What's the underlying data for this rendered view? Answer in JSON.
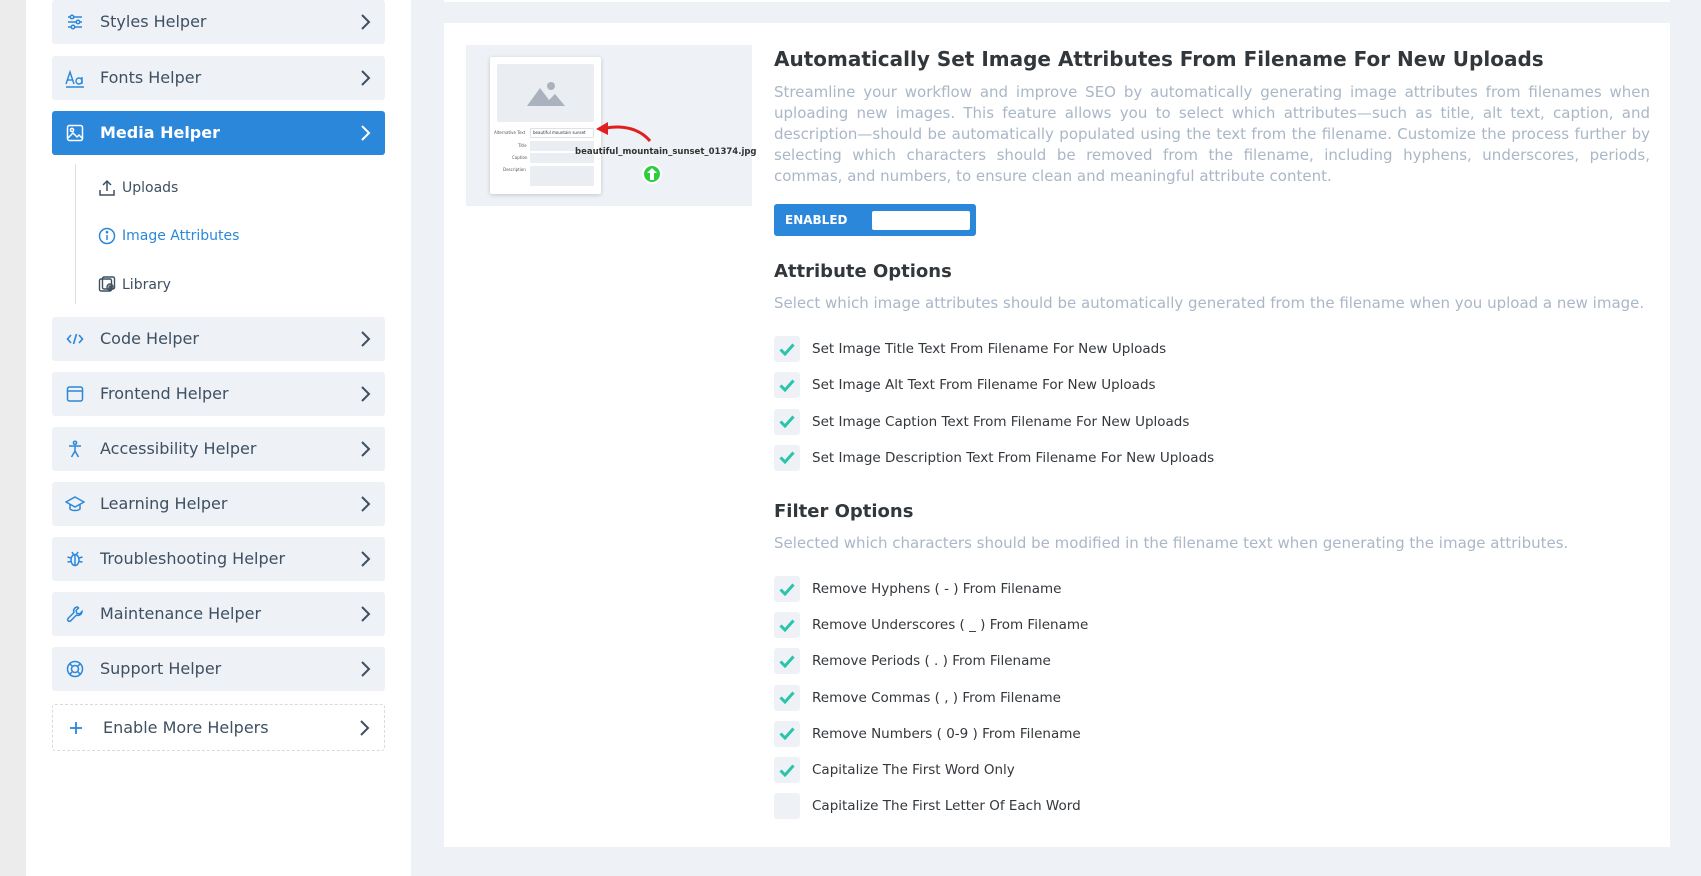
{
  "sidebar": {
    "helpers_top": [
      {
        "label": "Styles Helper",
        "icon": "sliders-icon"
      },
      {
        "label": "Fonts Helper",
        "icon": "font-icon"
      },
      {
        "label": "Media Helper",
        "icon": "image-icon"
      }
    ],
    "media_sub": [
      {
        "label": "Uploads",
        "icon": "upload-icon"
      },
      {
        "label": "Image Attributes",
        "icon": "info-icon"
      },
      {
        "label": "Library",
        "icon": "library-icon"
      }
    ],
    "helpers_bottom": [
      {
        "label": "Code Helper",
        "icon": "code-icon"
      },
      {
        "label": "Frontend Helper",
        "icon": "browser-icon"
      },
      {
        "label": "Accessibility Helper",
        "icon": "accessibility-icon"
      },
      {
        "label": "Learning Helper",
        "icon": "graduation-cap-icon"
      },
      {
        "label": "Troubleshooting Helper",
        "icon": "bug-icon"
      },
      {
        "label": "Maintenance Helper",
        "icon": "wrench-icon"
      },
      {
        "label": "Support Helper",
        "icon": "lifebuoy-icon"
      }
    ],
    "enable_more": {
      "label": "Enable More Helpers",
      "icon": "plus-icon"
    }
  },
  "main": {
    "thumbnail": {
      "alt_label": "Alternative Text",
      "alt_value": "beautiful mountain sunset",
      "title_label": "Title",
      "caption_label": "Caption",
      "description_label": "Description",
      "filename": "beautiful_mountain_sunset_01374.jpg"
    },
    "title": "Automatically Set Image Attributes From Filename For New Uploads",
    "description": "Streamline your workflow and improve SEO by automatically generating image attributes from filenames when uploading new images. This feature allows you to select which attributes—such as title, alt text, caption, and description—should be automatically populated using the text from the filename. Customize the process further by selecting which characters should be removed from the filename, including hyphens, underscores, periods, commas, and numbers, to ensure clean and meaningful attribute content.",
    "toggle": {
      "label": "ENABLED",
      "state": true
    },
    "attribute_options": {
      "heading": "Attribute Options",
      "subtext": "Select which image attributes should be automatically generated from the filename when you upload a new image.",
      "items": [
        {
          "label": "Set Image Title Text From Filename For New Uploads",
          "checked": true
        },
        {
          "label": "Set Image Alt Text From Filename For New Uploads",
          "checked": true
        },
        {
          "label": "Set Image Caption Text From Filename For New Uploads",
          "checked": true
        },
        {
          "label": "Set Image Description Text From Filename For New Uploads",
          "checked": true
        }
      ]
    },
    "filter_options": {
      "heading": "Filter Options",
      "subtext": "Selected which characters should be modified in the filename text when generating the image attributes.",
      "items": [
        {
          "label": "Remove Hyphens ( - ) From Filename",
          "checked": true
        },
        {
          "label": "Remove Underscores ( _ ) From Filename",
          "checked": true
        },
        {
          "label": "Remove Periods ( . ) From Filename",
          "checked": true
        },
        {
          "label": "Remove Commas ( , ) From Filename",
          "checked": true
        },
        {
          "label": "Remove Numbers ( 0-9 ) From Filename",
          "checked": true
        },
        {
          "label": "Capitalize The First Word Only",
          "checked": true
        },
        {
          "label": "Capitalize The First Letter Of Each Word",
          "checked": false
        }
      ]
    }
  },
  "colors": {
    "accent": "#2b87da",
    "check": "#29c4a9",
    "muted_text": "#a9b7c7",
    "panel_bg": "#eef1f5"
  }
}
